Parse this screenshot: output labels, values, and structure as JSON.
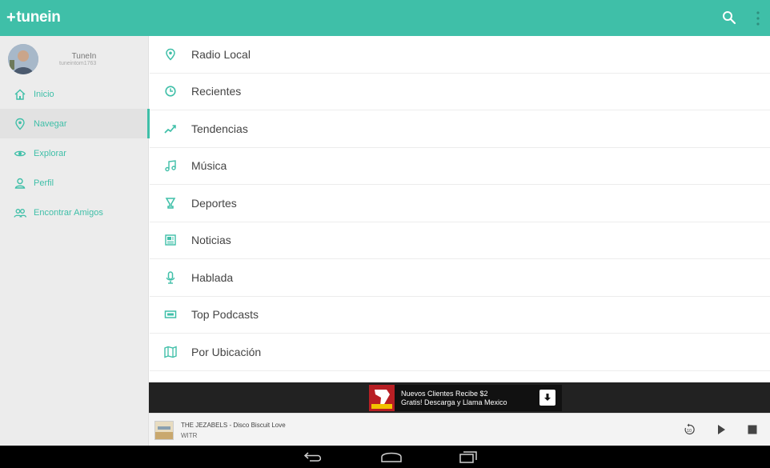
{
  "app": {
    "logo_text": "tunein",
    "logo_symbol": "+",
    "accent_color": "#3fbfa8"
  },
  "topbar": {
    "search_icon": "search-icon",
    "menu_icon": "overflow-menu-icon"
  },
  "profile": {
    "name": "TuneIn",
    "username": "tuneintom1763"
  },
  "sidebar": {
    "items": [
      {
        "label": "Inicio",
        "icon": "home-icon"
      },
      {
        "label": "Navegar",
        "icon": "location-pin-icon",
        "active": true
      },
      {
        "label": "Explorar",
        "icon": "eye-icon"
      },
      {
        "label": "Perfil",
        "icon": "person-icon"
      },
      {
        "label": "Encontrar Amigos",
        "icon": "friends-icon"
      }
    ]
  },
  "categories": [
    {
      "label": "Radio Local",
      "icon": "location-pin-icon"
    },
    {
      "label": "Recientes",
      "icon": "clock-icon"
    },
    {
      "label": "Tendencias",
      "icon": "trending-icon"
    },
    {
      "label": "Música",
      "icon": "music-note-icon"
    },
    {
      "label": "Deportes",
      "icon": "trophy-icon"
    },
    {
      "label": "Noticias",
      "icon": "newspaper-icon"
    },
    {
      "label": "Hablada",
      "icon": "microphone-icon"
    },
    {
      "label": "Top Podcasts",
      "icon": "podcast-icon"
    },
    {
      "label": "Por Ubicación",
      "icon": "map-icon"
    }
  ],
  "ad": {
    "line1": "Nuevos Clientes Recibe $2",
    "line2": "Gratis! Descarga y Llama Mexico"
  },
  "player": {
    "track": "THE JEZABELS - Disco Biscuit Love",
    "station": "WITR",
    "rewind_label": "10"
  },
  "system_nav": [
    "back-icon",
    "home-nav-icon",
    "recents-icon"
  ]
}
